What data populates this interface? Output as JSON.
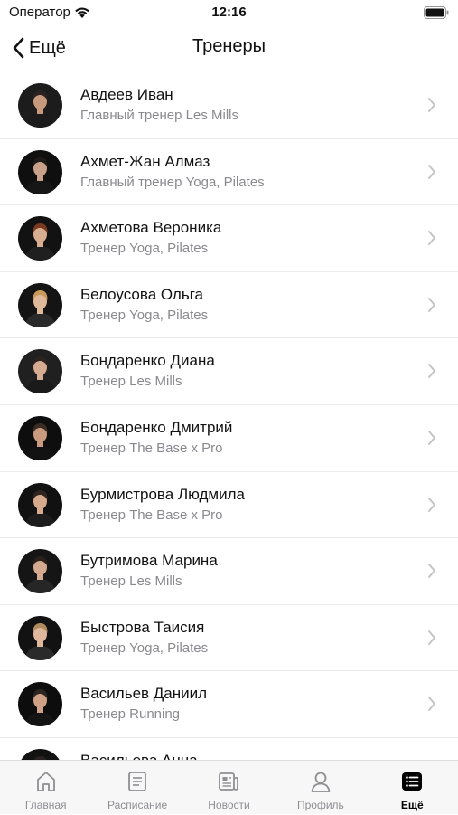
{
  "status": {
    "carrier": "Оператор",
    "time": "12:16"
  },
  "nav": {
    "back_label": "Ещё",
    "title": "Тренеры"
  },
  "trainers": [
    {
      "name": "Авдеев Иван",
      "role": "Главный тренер Les Mills",
      "skin": "#c79a7e",
      "hair": "#2a2220",
      "shirt": "#1b1b1b",
      "bg": "#1c1c1c"
    },
    {
      "name": "Ахмет-Жан Алмаз",
      "role": "Главный тренер Yoga, Pilates",
      "skin": "#c9a188",
      "hair": "#1e1a18",
      "shirt": "#161616",
      "bg": "#0f0f0f"
    },
    {
      "name": "Ахметова Вероника",
      "role": "Тренер Yoga, Pilates",
      "skin": "#d9ad90",
      "hair": "#7a3a22",
      "shirt": "#1f1f1f",
      "bg": "#121212"
    },
    {
      "name": "Белоусова Ольга",
      "role": "Тренер Yoga, Pilates",
      "skin": "#e0b89a",
      "hair": "#c99b5a",
      "shirt": "#2a2a2a",
      "bg": "#141414"
    },
    {
      "name": "Бондаренко Диана",
      "role": "Тренер Les Mills",
      "skin": "#d6ab91",
      "hair": "#2b2320",
      "shirt": "#1a1a1a",
      "bg": "#202020"
    },
    {
      "name": "Бондаренко Дмитрий",
      "role": "Тренер The Base x Pro",
      "skin": "#c99a7e",
      "hair": "#3a2c24",
      "shirt": "#121212",
      "bg": "#0e0e0e"
    },
    {
      "name": "Бурмистрова Людмила",
      "role": "Тренер The Base x Pro",
      "skin": "#d6a98c",
      "hair": "#2f2420",
      "shirt": "#1c1c1c",
      "bg": "#111111"
    },
    {
      "name": "Бутримова Марина",
      "role": "Тренер Les Mills",
      "skin": "#d4a98f",
      "hair": "#2a211d",
      "shirt": "#262626",
      "bg": "#151515"
    },
    {
      "name": "Быстрова Таисия",
      "role": "Тренер Yoga, Pilates",
      "skin": "#e0b89e",
      "hair": "#b08b5c",
      "shirt": "#2a2a2a",
      "bg": "#121212"
    },
    {
      "name": "Васильев Даниил",
      "role": "Тренер Running",
      "skin": "#cfa086",
      "hair": "#2c2420",
      "shirt": "#141414",
      "bg": "#0d0d0d"
    },
    {
      "name": "Васильева Анна",
      "role": "",
      "skin": "#d8ad93",
      "hair": "#2a2220",
      "shirt": "#1a1a1a",
      "bg": "#121212"
    }
  ],
  "tabs": [
    {
      "label": "Главная",
      "icon": "home-icon",
      "active": false
    },
    {
      "label": "Расписание",
      "icon": "schedule-icon",
      "active": false
    },
    {
      "label": "Новости",
      "icon": "news-icon",
      "active": false
    },
    {
      "label": "Профиль",
      "icon": "profile-icon",
      "active": false
    },
    {
      "label": "Ещё",
      "icon": "more-icon",
      "active": true
    }
  ],
  "colors": {
    "text": "#111111",
    "secondary": "#8a8a8e",
    "chevron": "#c4c4c7",
    "tab_inactive": "#8e8e93",
    "tab_active": "#000000"
  }
}
